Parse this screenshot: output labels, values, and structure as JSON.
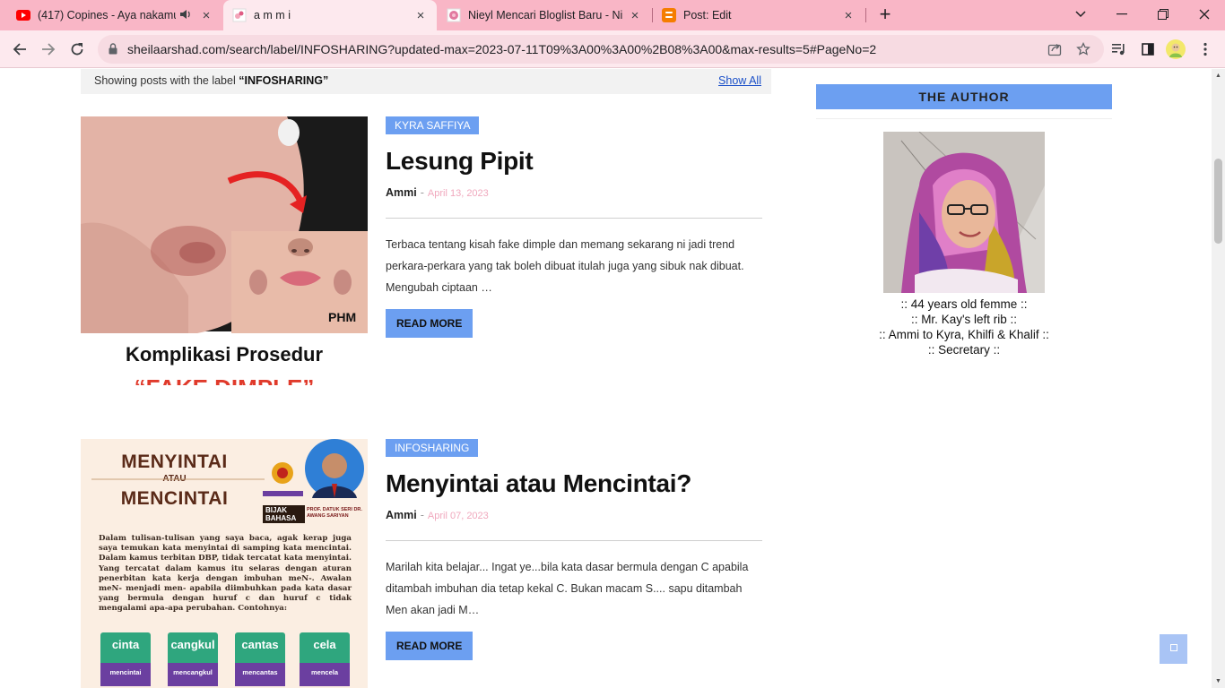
{
  "browser": {
    "tabs": [
      {
        "title": "(417) Copines - Aya nakamu",
        "icon": "youtube-icon"
      },
      {
        "title": "a m m i",
        "icon": "blog-favicon"
      },
      {
        "title": "Nieyl Mencari Bloglist Baru - Nie",
        "icon": "blog-favicon"
      },
      {
        "title": "Post: Edit",
        "icon": "blogger-icon"
      }
    ],
    "url": "sheilaarshad.com/search/label/INFOSHARING?updated-max=2023-07-11T09%3A00%3A00%2B08%3A00&max-results=5#PageNo=2"
  },
  "label_bar": {
    "prefix": "Showing posts with the label",
    "label": "“INFOSHARING”",
    "show_all": "Show All"
  },
  "posts": [
    {
      "category": "KYRA SAFFIYA",
      "title": "Lesung Pipit",
      "author": "Ammi",
      "separator": "-",
      "date": "April 13, 2023",
      "excerpt": "Terbaca tentang kisah fake dimple dan memang sekarang ni jadi trend perkara-perkara yang tak boleh dibuat itulah juga yang sibuk nak dibuat. Mengubah ciptaan …",
      "read_more": "READ MORE",
      "image": {
        "watermark": "PHM",
        "caption_line1": "Komplikasi Prosedur",
        "caption_line2": "“FAKE DIMPLE”"
      }
    },
    {
      "category": "INFOSHARING",
      "title": "Menyintai atau Mencintai?",
      "author": "Ammi",
      "separator": "-",
      "date": "April 07, 2023",
      "excerpt": "Marilah kita belajar... Ingat ye...bila kata dasar bermula dengan C apabila ditambah imbuhan dia tetap kekal C. Bukan macam S.... sapu ditambah Men akan jadi M…",
      "read_more": "READ MORE",
      "image": {
        "heading1": "MENYINTAI",
        "heading2": "ATAU",
        "heading3": "MENCINTAI",
        "tag1": "BIJAK",
        "tag2": "BAHASA",
        "person": "PROF. DATUK SERI DR. AWANG SARIYAN",
        "body": "Dalam tulisan-tulisan yang saya baca, agak kerap juga saya temukan kata menyintai di samping kata mencintai. Dalam kamus terbitan DBP, tidak tercatat kata menyintai. Yang tercatat dalam kamus itu selaras dengan aturan penerbitan kata kerja dengan imbuhan meN-. Awalan meN- menjadi men- apabila diimbuhkan pada kata dasar yang bermula dengan huruf c dan huruf c tidak mengalami apa-apa perubahan. Contohnya:",
        "words": [
          {
            "root": "cinta",
            "derived": "mencintai"
          },
          {
            "root": "cangkul",
            "derived": "mencangkul"
          },
          {
            "root": "cantas",
            "derived": "mencantas"
          },
          {
            "root": "cela",
            "derived": "mencela"
          }
        ]
      }
    }
  ],
  "sidebar": {
    "heading": "THE AUTHOR",
    "lines": [
      ":: 44 years old femme ::",
      ":: Mr. Kay's left rib ::",
      ":: Ammi to Kyra, Khilfi & Khalif ::",
      ":: Secretary ::"
    ]
  },
  "colors": {
    "tabbar": "#f9b6c6",
    "accent": "#6c9ff1",
    "date": "#f0a8bd"
  }
}
